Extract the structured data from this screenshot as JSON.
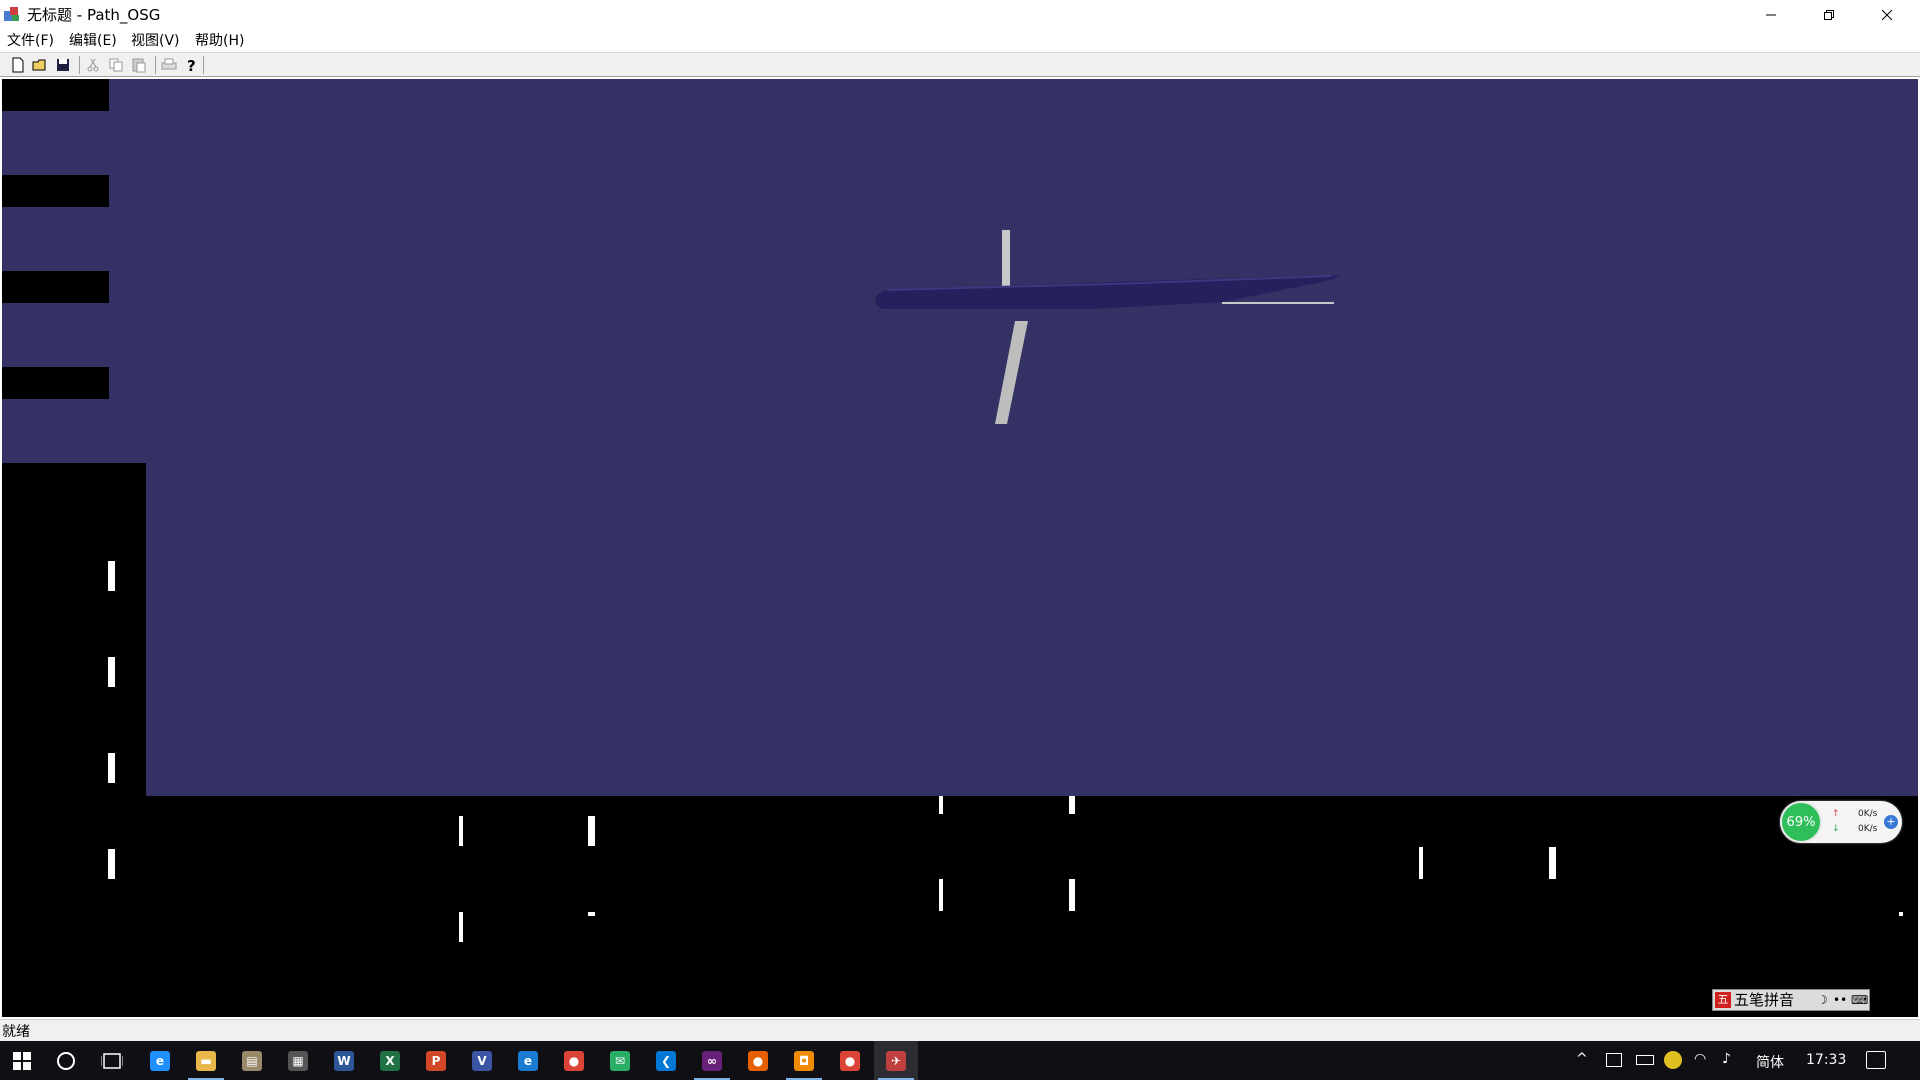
{
  "window": {
    "title": "无标题 - Path_OSG",
    "controls": {
      "minimize": "—",
      "restore": "❐",
      "close": "✕"
    }
  },
  "menu": [
    "文件(F)",
    "编辑(E)",
    "视图(V)",
    "帮助(H)"
  ],
  "toolbar": {
    "buttons": [
      "new-icon",
      "open-icon",
      "save-icon",
      "cut-icon",
      "copy-icon",
      "paste-icon",
      "print-icon",
      "help-icon"
    ]
  },
  "viewport": {
    "sky_color": "#343264",
    "ground_color": "#000000",
    "aircraft_color": "#2a2360",
    "wing_color": "#c8c8c8"
  },
  "statusbar": {
    "text": "就绪"
  },
  "net_widget": {
    "percent": "69%",
    "up": "0K/s",
    "down": "0K/s"
  },
  "ime": {
    "label": "五笔拼音"
  },
  "taskbar": {
    "apps": [
      {
        "name": "edge",
        "glyph": "e",
        "color": "#1e90ff"
      },
      {
        "name": "file-explorer",
        "glyph": "▬",
        "color": "#e8b84a"
      },
      {
        "name": "app-notepad",
        "glyph": "▤",
        "color": "#9a8a6a"
      },
      {
        "name": "calculator",
        "glyph": "▦",
        "color": "#555"
      },
      {
        "name": "word",
        "glyph": "W",
        "color": "#2b5797"
      },
      {
        "name": "excel",
        "glyph": "X",
        "color": "#1f7244"
      },
      {
        "name": "powerpoint",
        "glyph": "P",
        "color": "#d24726"
      },
      {
        "name": "visio",
        "glyph": "V",
        "color": "#3955a3"
      },
      {
        "name": "ie",
        "glyph": "e",
        "color": "#1a7bd0"
      },
      {
        "name": "chrome",
        "glyph": "●",
        "color": "#db4437"
      },
      {
        "name": "wechat",
        "glyph": "✉",
        "color": "#2aae67"
      },
      {
        "name": "vscode",
        "glyph": "❮",
        "color": "#0078d4"
      },
      {
        "name": "visual-studio",
        "glyph": "∞",
        "color": "#68217a"
      },
      {
        "name": "firefox",
        "glyph": "●",
        "color": "#e66000"
      },
      {
        "name": "app-orange",
        "glyph": "◘",
        "color": "#f08a00"
      },
      {
        "name": "chrome-2",
        "glyph": "●",
        "color": "#db4437"
      },
      {
        "name": "path-osg",
        "glyph": "✈",
        "color": "#c04040"
      }
    ],
    "tray": {
      "ime_mode": "简体",
      "time": "17:33"
    }
  }
}
